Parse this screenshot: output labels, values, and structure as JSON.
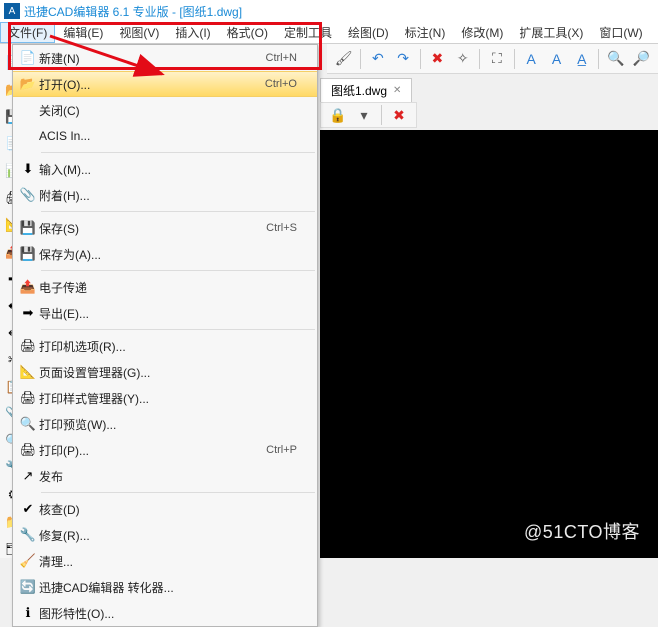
{
  "title": "迅捷CAD编辑器 6.1 专业版  -  [图纸1.dwg]",
  "app_icon_text": "A",
  "menubar": [
    {
      "label": "文件(F)",
      "active": true
    },
    {
      "label": "编辑(E)"
    },
    {
      "label": "视图(V)"
    },
    {
      "label": "插入(I)"
    },
    {
      "label": "格式(O)"
    },
    {
      "label": "定制工具"
    },
    {
      "label": "绘图(D)"
    },
    {
      "label": "标注(N)"
    },
    {
      "label": "修改(M)"
    },
    {
      "label": "扩展工具(X)"
    },
    {
      "label": "窗口(W)"
    }
  ],
  "file_menu": [
    {
      "icon": "📄",
      "label": "新建(N)",
      "shortcut": "Ctrl+N",
      "submenu": false
    },
    {
      "icon": "📂",
      "label": "打开(O)...",
      "shortcut": "Ctrl+O",
      "submenu": false,
      "hover": true
    },
    {
      "icon": "",
      "label": "关闭(C)",
      "shortcut": "",
      "submenu": false
    },
    {
      "icon": "",
      "label": "ACIS In...",
      "shortcut": "",
      "submenu": false
    },
    {
      "divider": true
    },
    {
      "icon": "⬇",
      "label": "输入(M)...",
      "shortcut": "",
      "submenu": false
    },
    {
      "icon": "📎",
      "label": "附着(H)...",
      "shortcut": "",
      "submenu": false
    },
    {
      "divider": true
    },
    {
      "icon": "💾",
      "label": "保存(S)",
      "shortcut": "Ctrl+S",
      "submenu": false
    },
    {
      "icon": "💾",
      "label": "保存为(A)...",
      "shortcut": "",
      "submenu": false
    },
    {
      "divider": true
    },
    {
      "icon": "📤",
      "label": "电子传递",
      "shortcut": "",
      "submenu": false
    },
    {
      "icon": "➡",
      "label": "导出(E)...",
      "shortcut": "",
      "submenu": false
    },
    {
      "divider": true
    },
    {
      "icon": "🖨",
      "label": "打印机选项(R)...",
      "shortcut": "",
      "submenu": false
    },
    {
      "icon": "📐",
      "label": "页面设置管理器(G)...",
      "shortcut": "",
      "submenu": false
    },
    {
      "icon": "🖨",
      "label": "打印样式管理器(Y)...",
      "shortcut": "",
      "submenu": false
    },
    {
      "icon": "🔍",
      "label": "打印预览(W)...",
      "shortcut": "",
      "submenu": false
    },
    {
      "icon": "🖨",
      "label": "打印(P)...",
      "shortcut": "Ctrl+P",
      "submenu": false
    },
    {
      "icon": "↗",
      "label": "发布",
      "shortcut": "",
      "submenu": false
    },
    {
      "divider": true
    },
    {
      "icon": "✔",
      "label": "核查(D)",
      "shortcut": "",
      "submenu": false
    },
    {
      "icon": "🔧",
      "label": "修复(R)...",
      "shortcut": "",
      "submenu": false
    },
    {
      "icon": "🧹",
      "label": "清理...",
      "shortcut": "",
      "submenu": false
    },
    {
      "icon": "🔄",
      "label": "迅捷CAD编辑器 转化器...",
      "shortcut": "",
      "submenu": false
    },
    {
      "icon": "ℹ",
      "label": "图形特性(O)...",
      "shortcut": "",
      "submenu": false
    }
  ],
  "left_icons": [
    "📄",
    "📂",
    "💾",
    "📑",
    "📊",
    "🖨",
    "📐",
    "📤",
    "➡",
    "⬅",
    "↩",
    "✂",
    "📋",
    "📎",
    "🔍",
    "🔧",
    "⚙",
    "📁",
    "🗂"
  ],
  "toolbar_right_row1": [
    {
      "glyph": "🖌",
      "name": "brush-icon"
    },
    {
      "sep": true
    },
    {
      "glyph": "↶",
      "name": "undo-icon",
      "class": "clr-blue"
    },
    {
      "glyph": "↷",
      "name": "redo-icon",
      "class": "clr-blue"
    },
    {
      "sep": true
    },
    {
      "glyph": "✖",
      "name": "erase-icon",
      "class": "clr-red"
    },
    {
      "glyph": "✧",
      "name": "spark-icon"
    },
    {
      "sep": true
    },
    {
      "glyph": "⛶",
      "name": "select-icon"
    },
    {
      "sep": true
    },
    {
      "glyph": "A",
      "name": "text-a-icon",
      "class": "clr-blue"
    },
    {
      "glyph": "A",
      "name": "text-a2-icon",
      "class": "clr-blue"
    },
    {
      "glyph": "A̲",
      "name": "text-underline-icon",
      "class": "clr-blue"
    },
    {
      "sep": true
    },
    {
      "glyph": "🔍",
      "name": "find-icon"
    },
    {
      "glyph": "🔎",
      "name": "find2-icon"
    }
  ],
  "tab": {
    "label": "图纸1.dwg"
  },
  "subtoolbar": [
    {
      "glyph": "🔒",
      "name": "lock-icon"
    },
    {
      "glyph": "▾",
      "name": "dropdown-icon"
    },
    {
      "sep": true
    },
    {
      "glyph": "✖",
      "name": "close-x-icon",
      "class": "clr-red"
    }
  ],
  "watermark": "@51CTO博客"
}
